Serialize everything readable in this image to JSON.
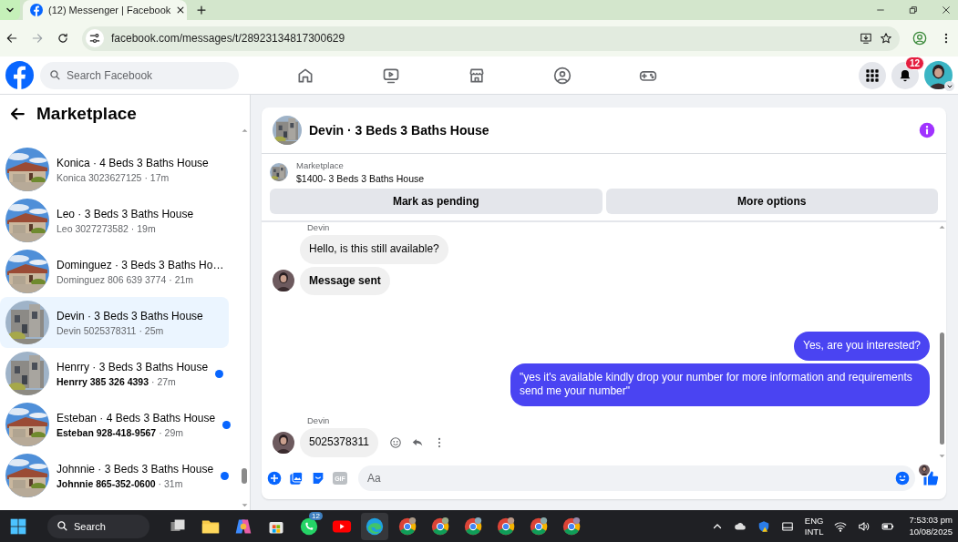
{
  "browser": {
    "tab_title": "(12) Messenger | Facebook",
    "url": "facebook.com/messages/t/28923134817300629"
  },
  "header": {
    "search_placeholder": "Search Facebook",
    "notification_count": "12"
  },
  "sidebar": {
    "title": "Marketplace",
    "conversations": [
      {
        "title": "Konica · 4 Beds 3 Baths House",
        "preview": "Konica 3023627125",
        "time": "· 17m",
        "unread": false,
        "selected": false
      },
      {
        "title": "Leo · 3 Beds 3 Baths House",
        "preview": "Leo 3027273582",
        "time": "· 19m",
        "unread": false,
        "selected": false
      },
      {
        "title": "Dominguez · 3 Beds 3 Baths Ho…",
        "preview": "Dominguez 806 639 3774",
        "time": "· 21m",
        "unread": false,
        "selected": false
      },
      {
        "title": "Devin · 3 Beds 3 Baths House",
        "preview": "Devin 5025378311",
        "time": "· 25m",
        "unread": false,
        "selected": true
      },
      {
        "title": "Henrry · 3 Beds 3 Baths House",
        "preview": "Henrry 385 326 4393",
        "time": "· 27m",
        "unread": true,
        "selected": false
      },
      {
        "title": "Esteban · 4 Beds 3 Baths House",
        "preview": "Esteban 928-418-9567",
        "time": "· 29m",
        "unread": true,
        "selected": false
      },
      {
        "title": "Johnnie · 3 Beds 3 Baths House",
        "preview": "Johnnie 865-352-0600",
        "time": "· 31m",
        "unread": true,
        "selected": false
      }
    ]
  },
  "chat": {
    "title": "Devin · 3 Beds 3 Baths House",
    "listing_label": "Marketplace",
    "listing_title": "$1400- 3 Beds 3 Baths House",
    "buttons": [
      "Mark as pending",
      "More options"
    ],
    "messages": [
      {
        "kind": "received",
        "sender": "Devin",
        "actions": false,
        "bubbles": [
          {
            "text": "Hello, is this still available?",
            "bold": false
          },
          {
            "text": "Message sent",
            "bold": true
          }
        ]
      },
      {
        "kind": "sent",
        "bubbles": [
          {
            "text": "Yes, are you interested?",
            "bold": false
          },
          {
            "text": "\"yes it's available kindly drop your number for more information and requirements send me your number\"",
            "bold": false
          }
        ]
      },
      {
        "kind": "received",
        "sender": "Devin",
        "actions": true,
        "bubbles": [
          {
            "text": "5025378311",
            "bold": false
          }
        ]
      }
    ],
    "composer": {
      "gif_label": "GIF",
      "placeholder": "Aa"
    }
  },
  "taskbar": {
    "search_label": "Search",
    "whatsapp_badge": "12",
    "language": "ENG",
    "layout": "INTL",
    "time": "7:53:03 pm",
    "date": "10/08/2025"
  }
}
